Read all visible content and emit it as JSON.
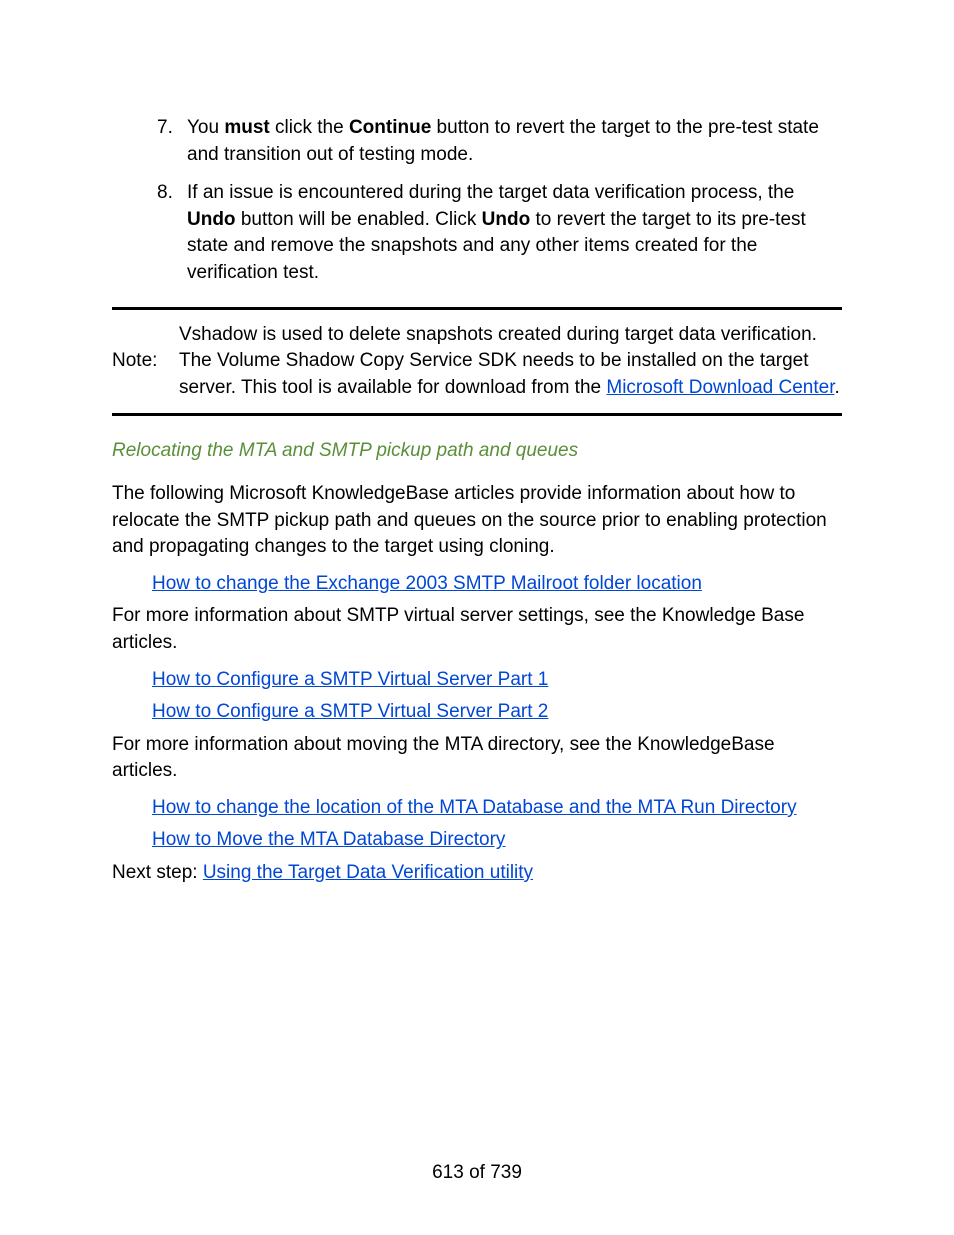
{
  "steps": [
    {
      "num": "7.",
      "pre_must": "You ",
      "must": "must",
      "post_must": " click the ",
      "continue": "Continue",
      "rest": " button to revert the target to the pre-test state and transition out of testing mode."
    },
    {
      "num": "8.",
      "pre_undo1": "If an issue is encountered during the target data verification process, the ",
      "undo1": "Undo",
      "mid": " button will be enabled. Click ",
      "undo2": "Undo",
      "rest": " to revert the target to its pre-test state and remove the snapshots and any other items created for the verification test."
    }
  ],
  "note": {
    "label": "Note:",
    "text_pre": "Vshadow is used to delete snapshots created during target data verification. The Volume Shadow Copy Service SDK needs to be installed on the target server. This tool is available for download from the ",
    "link": "Microsoft Download Center",
    "text_post": "."
  },
  "subheading": "Relocating the MTA and SMTP pickup path and queues",
  "para1": "The following Microsoft KnowledgeBase articles provide information about how to relocate the SMTP pickup path and queues on the source prior to enabling protection and propagating changes to the target using cloning.",
  "link1": "How to change the Exchange 2003 SMTP Mailroot folder location",
  "para2": "For more information about SMTP virtual server settings, see the Knowledge Base articles.",
  "link2": "How to Configure a SMTP Virtual Server Part 1",
  "link3": "How to Configure a SMTP Virtual Server Part 2",
  "para3": "For more information about moving the MTA directory, see the KnowledgeBase articles.",
  "link4": "How to change the location of the MTA Database and the MTA Run Directory",
  "link5": "How to Move the MTA Database Directory",
  "next_label": "Next step: ",
  "next_link": "Using the Target Data Verification utility",
  "footer": "613 of 739"
}
